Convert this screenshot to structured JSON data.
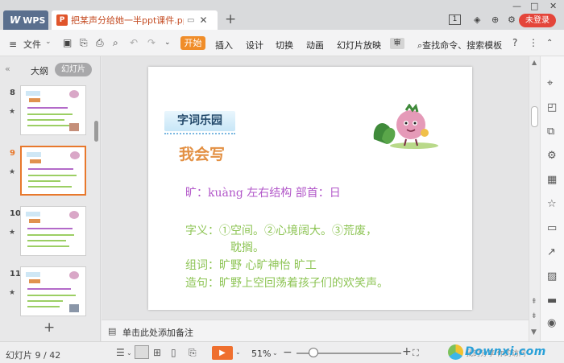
{
  "titlebar": {
    "app_name": "WPS",
    "doc_tab_title": "把某声分给她一半ppt课件.pptx",
    "doc_icon_letter": "P",
    "new_tab": "+",
    "badge_number": "1",
    "login_label": "未登录"
  },
  "toolbar": {
    "file_label": "文件",
    "tabs": [
      "开始",
      "插入",
      "设计",
      "切换",
      "动画",
      "幻灯片放映"
    ],
    "active_tab": "开始",
    "more_label": "审",
    "search_cmd": "查找命令、搜索模板"
  },
  "left_panel": {
    "outline_label": "大纲",
    "slides_label": "幻灯片",
    "thumbnails": [
      {
        "number": "8",
        "active": false
      },
      {
        "number": "9",
        "active": true
      },
      {
        "number": "10",
        "active": false
      },
      {
        "number": "11",
        "active": false
      }
    ],
    "add_slide": "+"
  },
  "slide": {
    "badge_text": "字词乐园",
    "heading": "我会写",
    "line1": "旷：kuàng      左右结构   部首：日",
    "line2": "字义：①空间。②心境阔大。③荒废，",
    "line3": "耽搁。",
    "line4": "组词：旷野   心旷神怡   旷工",
    "line5": "造句：旷野上空回荡着孩子们的欢笑声。"
  },
  "notes": {
    "placeholder": "单击此处添加备注"
  },
  "statusbar": {
    "slide_indicator": "幻灯片 9 / 42",
    "zoom": "51%",
    "zoom_fraction": 0.16,
    "watermark": "Downxi.com",
    "watermark_strip": "我的分享  你的访问"
  },
  "colors": {
    "accent_orange": "#f08d29",
    "login_red": "#e4453a",
    "heading_orange": "#e39043",
    "text_purple": "#b257c9",
    "text_green": "#8dc454"
  }
}
